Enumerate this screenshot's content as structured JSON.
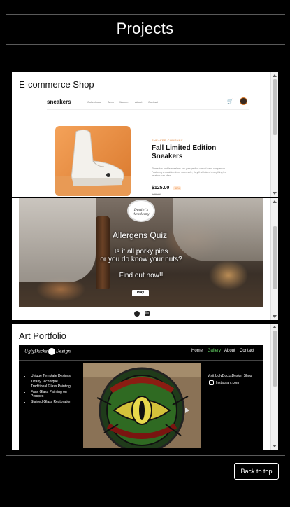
{
  "page": {
    "title": "Projects",
    "back_to_top": "Back to top"
  },
  "colors": {
    "background": "#000000",
    "accent_orange": "#e07b2a",
    "gallery_green": "#64d264"
  },
  "projects": [
    {
      "title": "E-commerce Shop",
      "preview": {
        "logo": "sneakers",
        "nav": [
          "Collections",
          "Men",
          "Women",
          "About",
          "Contact"
        ],
        "company": "SNEAKER COMPANY",
        "product": "Fall Limited Edition Sneakers",
        "description": "These low-profile sneakers are your perfect casual wear companion. Featuring a durable rubber outer sole, they'll withstand everything the weather can offer.",
        "price": "$125.00",
        "discount": "50%",
        "old_price": "$250.00",
        "cart_icon": "cart-icon",
        "avatar_icon": "avatar"
      }
    },
    {
      "title": "",
      "preview": {
        "logo_text": "Daniel's Academy",
        "heading": "Allergens Quiz",
        "line1": "Is it all porky pies",
        "line2": "or you do know your nuts?",
        "line3": "Find out now!!",
        "play": "Play",
        "icons": [
          "github-icon",
          "linkedin-icon"
        ]
      }
    },
    {
      "title": "Art Portfolio",
      "preview": {
        "logo_left": "UglyDucks",
        "logo_right": "Design",
        "nav": [
          "Home",
          "Gallery",
          "About",
          "Contact"
        ],
        "active_nav": "Gallery",
        "list": [
          "Unique Template Designs",
          "Tiffany Technique",
          "Traditional Glass Painting",
          "Faux Glass Painting on Perspex",
          "Stained Glass Restoration"
        ],
        "shop": "Visit UglyDucksDesign Shop",
        "instagram": "Instagram.com"
      }
    }
  ]
}
